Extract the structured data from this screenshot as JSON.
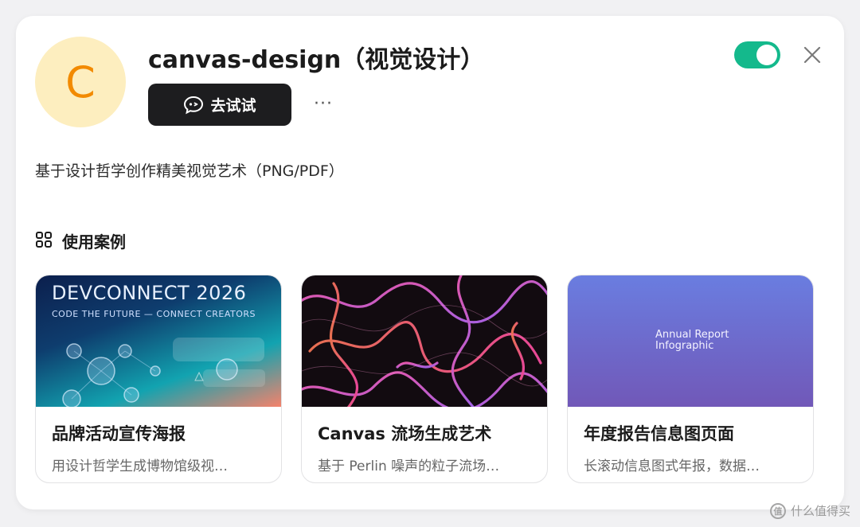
{
  "skill": {
    "avatar_letter": "C",
    "title": "canvas-design（视觉设计）",
    "try_label": "去试试",
    "more_label": "···",
    "enabled": true,
    "description": "基于设计哲学创作精美视觉艺术（PNG/PDF）"
  },
  "section": {
    "title": "使用案例"
  },
  "cases": [
    {
      "title": "品牌活动宣传海报",
      "desc": "用设计哲学生成博物馆级视…",
      "thumb_heading": "DEVCONNECT 2026",
      "thumb_sub": "CODE THE FUTURE — CONNECT CREATORS"
    },
    {
      "title": "Canvas 流场生成艺术",
      "desc": "基于 Perlin 噪声的粒子流场…"
    },
    {
      "title": "年度报告信息图页面",
      "desc": "长滚动信息图式年报，数据…",
      "thumb_text_1": "Annual Report",
      "thumb_text_2": "Infographic"
    }
  ],
  "watermark": {
    "text": "什么值得买",
    "icon_glyph": "值"
  },
  "colors": {
    "toggle_on": "#14b98c",
    "avatar_bg": "#fdeebf",
    "avatar_fg": "#f28a00",
    "button_bg": "#1d1d1f"
  }
}
